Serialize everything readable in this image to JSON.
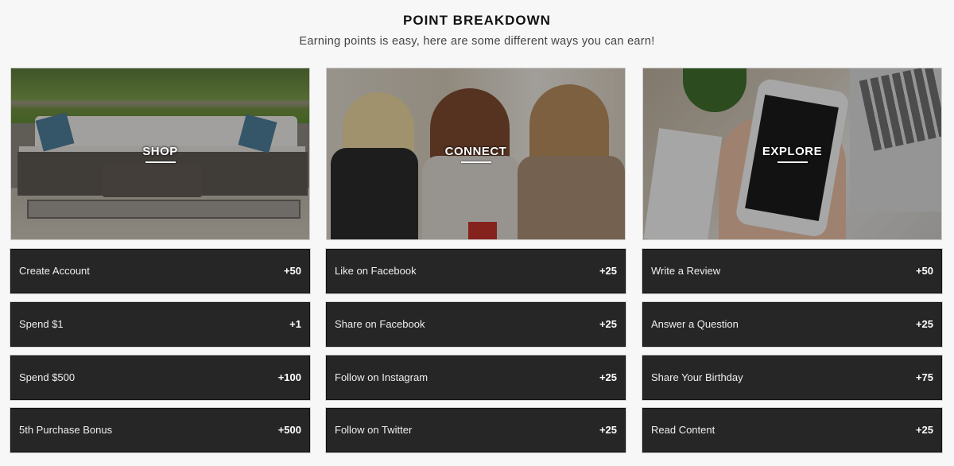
{
  "header": {
    "title": "POINT BREAKDOWN",
    "subtitle": "Earning points is easy, here are some different ways you can earn!"
  },
  "columns": [
    {
      "category": "SHOP",
      "image": "patio-sofa-photo",
      "items": [
        {
          "label": "Create Account",
          "points": "+50"
        },
        {
          "label": "Spend $1",
          "points": "+1"
        },
        {
          "label": "Spend $500",
          "points": "+100"
        },
        {
          "label": "5th Purchase Bonus",
          "points": "+500"
        }
      ]
    },
    {
      "category": "CONNECT",
      "image": "friends-laughing-photo",
      "items": [
        {
          "label": "Like on Facebook",
          "points": "+25"
        },
        {
          "label": "Share on Facebook",
          "points": "+25"
        },
        {
          "label": "Follow on Instagram",
          "points": "+25"
        },
        {
          "label": "Follow on Twitter",
          "points": "+25"
        }
      ]
    },
    {
      "category": "EXPLORE",
      "image": "phone-in-hand-photo",
      "items": [
        {
          "label": "Write a Review",
          "points": "+50"
        },
        {
          "label": "Answer a Question",
          "points": "+25"
        },
        {
          "label": "Share Your Birthday",
          "points": "+75"
        },
        {
          "label": "Read Content",
          "points": "+25"
        }
      ]
    }
  ],
  "colors": {
    "page_bg": "#f7f7f7",
    "row_bg": "#262626",
    "row_text": "#eeeeee"
  }
}
